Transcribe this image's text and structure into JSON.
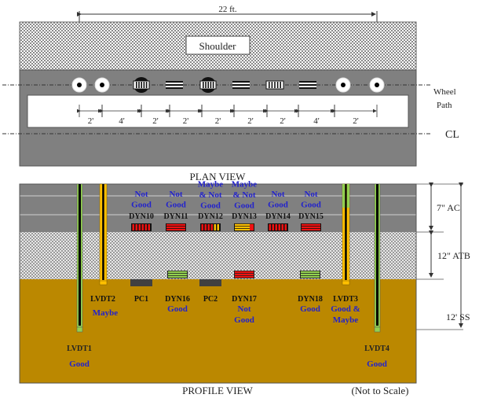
{
  "plan_view": {
    "title": "PLAN VIEW",
    "overall_dimension": "22 ft.",
    "shoulder_label": "Shoulder",
    "wheel_path_label": [
      "Wheel",
      "Path"
    ],
    "centerline_label": "CL",
    "spacings": [
      "2'",
      "4'",
      "2'",
      "2'",
      "2'",
      "2'",
      "2'",
      "4'",
      "2'"
    ],
    "sensors": [
      {
        "type": "lvdt"
      },
      {
        "type": "lvdt"
      },
      {
        "type": "pressure-cell"
      },
      {
        "type": "dyn-longitudinal"
      },
      {
        "type": "pressure-cell"
      },
      {
        "type": "dyn-longitudinal"
      },
      {
        "type": "dyn-transverse"
      },
      {
        "type": "dyn-longitudinal"
      },
      {
        "type": "lvdt"
      },
      {
        "type": "lvdt"
      }
    ]
  },
  "profile_view": {
    "title": "PROFILE VIEW",
    "scale_note": "(Not to Scale)",
    "layers": [
      {
        "name": "AC",
        "label": "7\" AC",
        "color": "#808080"
      },
      {
        "name": "ATB",
        "label": "12\" ATB",
        "color": "#c8c8c8"
      },
      {
        "name": "SS",
        "label": "12' SS",
        "color": "#bb8800"
      }
    ],
    "top_gauges": [
      {
        "id": "DYN10",
        "status": [
          "Not",
          "Good"
        ],
        "pattern": "vertical",
        "colors": [
          "#ee1111"
        ]
      },
      {
        "id": "DYN11",
        "status": [
          "Not",
          "Good"
        ],
        "pattern": "horizontal",
        "colors": [
          "#ee1111"
        ]
      },
      {
        "id": "DYN12",
        "status": [
          "Maybe",
          "& Not",
          "Good"
        ],
        "pattern": "vertical",
        "colors": [
          "#ee1111",
          "#ffc000"
        ]
      },
      {
        "id": "DYN13",
        "status": [
          "Maybe",
          "& Not",
          "Good"
        ],
        "pattern": "horizontal",
        "colors": [
          "#ffc000",
          "#ee1111"
        ]
      },
      {
        "id": "DYN14",
        "status": [
          "Not",
          "Good"
        ],
        "pattern": "vertical",
        "colors": [
          "#ee1111"
        ]
      },
      {
        "id": "DYN15",
        "status": [
          "Not",
          "Good"
        ],
        "pattern": "horizontal",
        "colors": [
          "#ee1111"
        ]
      }
    ],
    "bottom_sensors": [
      {
        "id": "LVDT2",
        "status": [
          "Maybe"
        ]
      },
      {
        "id": "PC1",
        "status": []
      },
      {
        "id": "DYN16",
        "status": [
          "Good"
        ],
        "color": "#92d050"
      },
      {
        "id": "PC2",
        "status": []
      },
      {
        "id": "DYN17",
        "status": [
          "Not",
          "Good"
        ],
        "color": "#ee1111"
      },
      {
        "id": "DYN18",
        "status": [
          "Good"
        ],
        "color": "#92d050"
      },
      {
        "id": "LVDT3",
        "status": [
          "Good &",
          "Maybe"
        ]
      }
    ],
    "deep_lvdts": [
      {
        "id": "LVDT1",
        "status": "Good"
      },
      {
        "id": "LVDT4",
        "status": "Good"
      }
    ]
  },
  "colors": {
    "status_text": "#2222cc",
    "good": "#92d050",
    "maybe": "#ffc000",
    "not_good": "#ee1111",
    "pc": "#404040"
  }
}
